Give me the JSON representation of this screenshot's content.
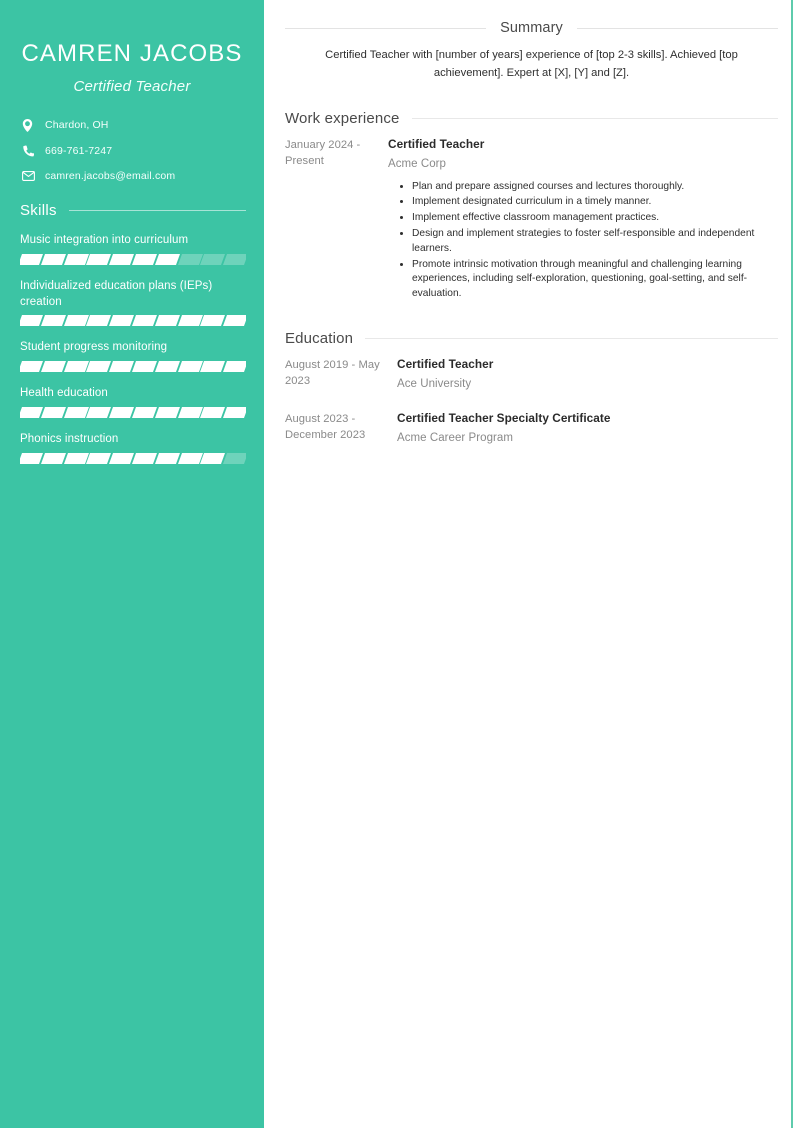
{
  "theme": {
    "accent": "#3cc4a4",
    "accent_line": "#5ecbac",
    "sidebar_text": "#ffffff",
    "body_text": "#2f2f2f",
    "muted_text": "#8a8a8a"
  },
  "sidebar": {
    "name": "CAMREN JACOBS",
    "title": "Certified Teacher",
    "contacts": [
      {
        "icon": "location-pin-icon",
        "value": "Chardon, OH"
      },
      {
        "icon": "phone-icon",
        "value": "669-761-7247"
      },
      {
        "icon": "envelope-icon",
        "value": "camren.jacobs@email.com"
      }
    ],
    "skills_heading": "Skills",
    "skills": [
      {
        "name": "Music integration into curriculum",
        "filled": 7,
        "total": 10
      },
      {
        "name": "Individualized education plans (IEPs) creation",
        "filled": 10,
        "total": 10
      },
      {
        "name": "Student progress monitoring",
        "filled": 10,
        "total": 10
      },
      {
        "name": "Health education",
        "filled": 10,
        "total": 10
      },
      {
        "name": "Phonics instruction",
        "filled": 9,
        "total": 10
      }
    ]
  },
  "main": {
    "summary": {
      "heading": "Summary",
      "text": "Certified Teacher with [number of years] experience of [top 2-3 skills]. Achieved [top achievement]. Expert at [X], [Y] and [Z]."
    },
    "work": {
      "heading": "Work experience",
      "entries": [
        {
          "dates": "January 2024 - Present",
          "role": "Certified Teacher",
          "org": "Acme Corp",
          "bullets": [
            "Plan and prepare assigned courses and lectures thoroughly.",
            "Implement designated curriculum in a timely manner.",
            "Implement effective classroom management practices.",
            "Design and implement strategies to foster self-responsible and independent learners.",
            "Promote intrinsic motivation through meaningful and challenging learning experiences, including self-exploration, questioning, goal-setting, and self-evaluation."
          ]
        }
      ]
    },
    "education": {
      "heading": "Education",
      "entries": [
        {
          "dates": "August 2019 - May 2023",
          "role": "Certified Teacher",
          "org": "Ace University"
        },
        {
          "dates": "August 2023 - December 2023",
          "role": "Certified Teacher Specialty Certificate",
          "org": "Acme Career Program"
        }
      ]
    }
  }
}
